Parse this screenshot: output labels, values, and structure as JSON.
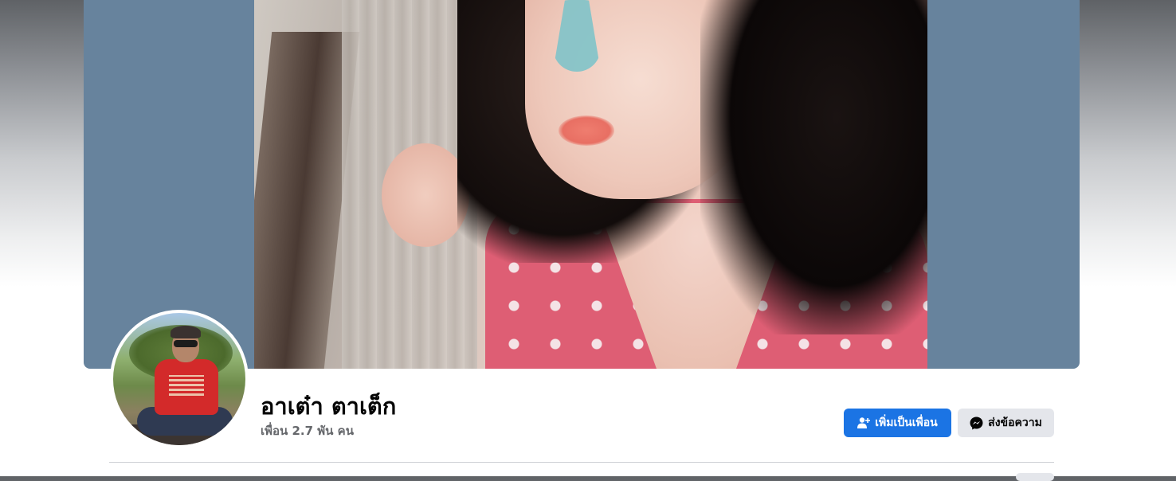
{
  "profile": {
    "name": "อาเต๋า ตาเต็ก",
    "friends": "เพื่อน 2.7 พัน คน"
  },
  "actions": {
    "add_friend_label": "เพิ่มเป็นเพื่อน",
    "add_friend_icon": "add-friend-icon",
    "message_label": "ส่งข้อความ",
    "message_icon": "messenger-icon"
  },
  "colors": {
    "primary_button": "#1b74e4",
    "secondary_button": "#e4e6eb",
    "cover_background": "#67839d",
    "name_text": "#050505",
    "secondary_text": "#65676b"
  }
}
